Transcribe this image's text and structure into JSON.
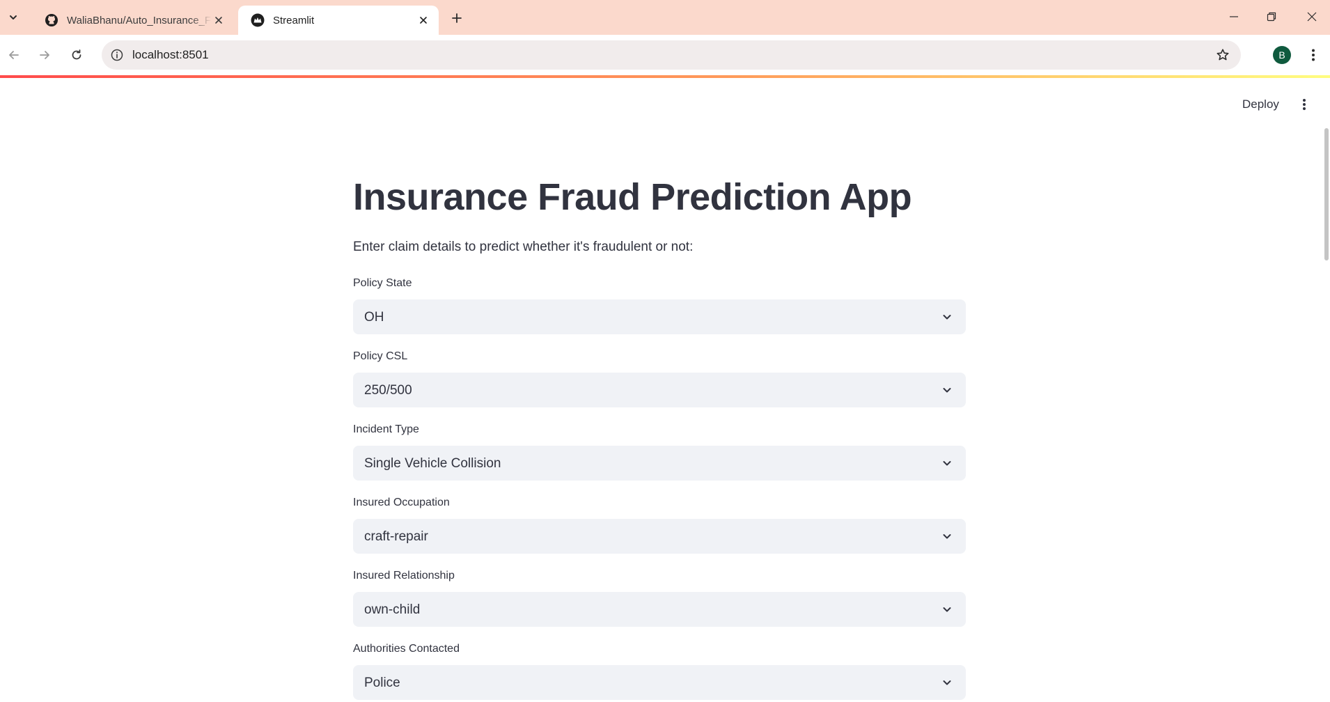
{
  "browser": {
    "tabs": [
      {
        "title": "WaliaBhanu/Auto_Insurance_Fra",
        "favicon": "github-icon",
        "active": false
      },
      {
        "title": "Streamlit",
        "favicon": "streamlit-icon",
        "active": true
      }
    ],
    "url": "localhost:8501",
    "profile_initial": "B"
  },
  "app": {
    "deploy_label": "Deploy",
    "title": "Insurance Fraud Prediction App",
    "subtitle": "Enter claim details to predict whether it's fraudulent or not:",
    "fields": [
      {
        "label": "Policy State",
        "value": "OH"
      },
      {
        "label": "Policy CSL",
        "value": "250/500"
      },
      {
        "label": "Incident Type",
        "value": "Single Vehicle Collision"
      },
      {
        "label": "Insured Occupation",
        "value": "craft-repair"
      },
      {
        "label": "Insured Relationship",
        "value": "own-child"
      },
      {
        "label": "Authorities Contacted",
        "value": "Police"
      }
    ]
  },
  "colors": {
    "tabstrip": "#fbd9cc",
    "accent": "#ff4b4b",
    "select_bg": "#f0f2f6",
    "text": "#31333f"
  }
}
